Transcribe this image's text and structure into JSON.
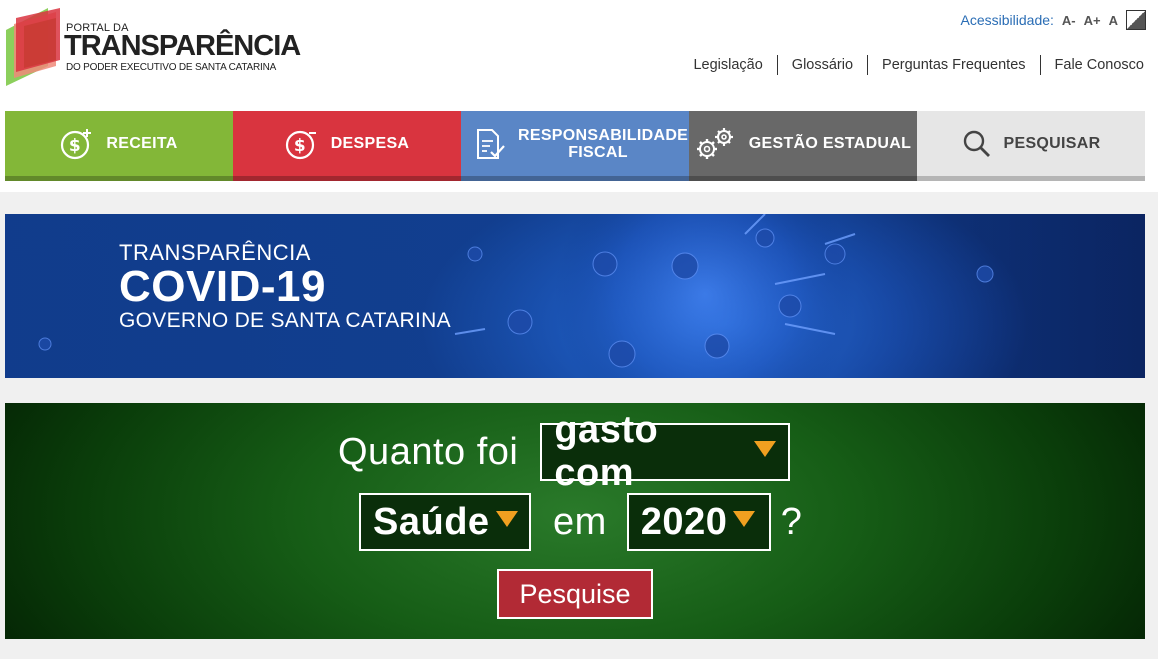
{
  "logo": {
    "line1": "PORTAL DA",
    "line2": "TRANSPARÊNCIA",
    "line3": "DO PODER EXECUTIVO DE SANTA CATARINA"
  },
  "accessibility": {
    "label": "Acessibilidade:",
    "decrease": "A-",
    "increase": "A+",
    "reset": "A",
    "contrast_icon": "contrast-icon"
  },
  "top_links": [
    "Legislação",
    "Glossário",
    "Perguntas Frequentes",
    "Fale Conosco"
  ],
  "nav": [
    {
      "label": "RECEITA",
      "icon": "dollar-plus-icon",
      "color": "#83b738"
    },
    {
      "label": "DESPESA",
      "icon": "dollar-minus-icon",
      "color": "#d9343f"
    },
    {
      "label": "RESPONSABILIDADE FISCAL",
      "icon": "document-check-icon",
      "color": "#5a86c6"
    },
    {
      "label": "GESTÃO ESTADUAL",
      "icon": "gears-icon",
      "color": "#686868"
    },
    {
      "label": "PESQUISAR",
      "icon": "search-icon",
      "color": "#e6e6e6"
    }
  ],
  "banner": {
    "line1": "TRANSPARÊNCIA",
    "line2": "COVID-19",
    "line3": "GOVERNO DE SANTA CATARINA"
  },
  "query": {
    "prefix": "Quanto foi",
    "type_value": "gasto com",
    "area_value": "Saúde",
    "connector": "em",
    "year_value": "2020",
    "suffix": "?",
    "button": "Pesquise",
    "accent_color": "#f0a020"
  }
}
